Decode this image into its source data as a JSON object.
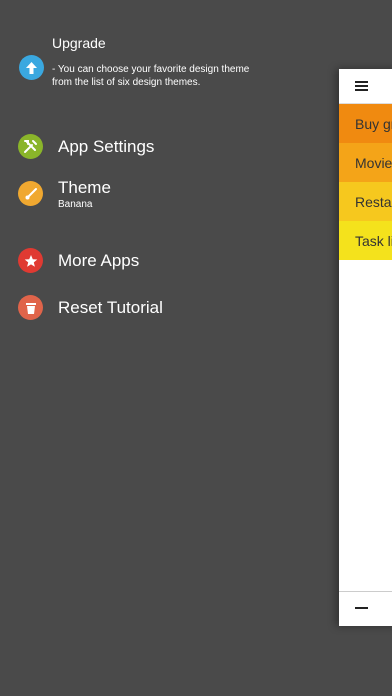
{
  "menu": {
    "upgrade": {
      "title": "Upgrade",
      "description": "- You can choose your favorite design theme from the list of six design themes.",
      "icon": "arrow-up-icon",
      "color": "#3aa8e0"
    },
    "app_settings": {
      "label": "App Settings",
      "icon": "tools-icon",
      "color": "#8ab52a"
    },
    "theme": {
      "label": "Theme",
      "value": "Banana",
      "icon": "brush-icon",
      "color": "#f0a830"
    },
    "more_apps": {
      "label": "More Apps",
      "icon": "star-icon",
      "color": "#e03a32"
    },
    "reset_tutorial": {
      "label": "Reset Tutorial",
      "icon": "trash-icon",
      "color": "#e0644a"
    }
  },
  "lists": [
    {
      "label": "Buy groceries",
      "color": "#f08a10"
    },
    {
      "label": "Movies",
      "color": "#f4a418"
    },
    {
      "label": "Restaurants",
      "color": "#f6c81e"
    },
    {
      "label": "Task list",
      "color": "#f4e21c"
    }
  ]
}
